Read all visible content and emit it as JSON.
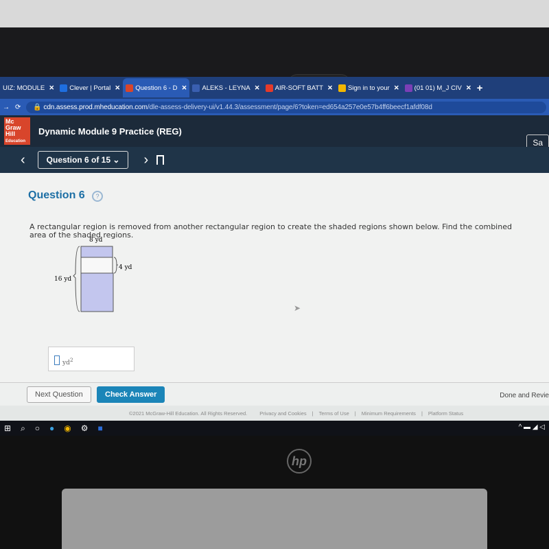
{
  "browser": {
    "tabs": [
      {
        "label": "UIZ: MODULE",
        "icon": "quiz-icon",
        "color": "#1f3f7a"
      },
      {
        "label": "Clever | Portal",
        "icon": "clever-icon",
        "color": "#1e6ee0"
      },
      {
        "label": "Question 6 - D",
        "icon": "mcgraw-hill-icon",
        "color": "#d8452b",
        "active": true
      },
      {
        "label": "ALEKS - LEYNA",
        "icon": "aleks-icon",
        "color": "#3a5fb0"
      },
      {
        "label": "AIR-SOFT BATT",
        "icon": "youtube-icon",
        "color": "#e53a2a"
      },
      {
        "label": "Sign in to your",
        "icon": "microsoft-icon",
        "color": "#f2b600"
      },
      {
        "label": "(01 01) M_J CIV",
        "icon": "onenote-icon",
        "color": "#7b3fb6"
      }
    ],
    "new_tab": "+",
    "url_host": "cdn.assess.prod.mheducation.com",
    "url_path": "/dle-assess-delivery-ui/v1.44.3/assessment/page/6?token=ed654a257e0e57b4ff6beecf1afdf08d"
  },
  "header": {
    "logo": "Mc Graw Hill Education",
    "logo_lines": [
      "Mc",
      "Graw",
      "Hill"
    ],
    "logo_sub": "Education",
    "title": "Dynamic Module 9 Practice (REG)",
    "save_label": "Sa"
  },
  "nav": {
    "question_selector": "Question 6 of 15"
  },
  "question": {
    "title": "Question 6",
    "text": "A rectangular region is removed from another rectangular region to create the shaded regions shown below. Find the combined area of the shaded regions.",
    "figure": {
      "width_label": "8 yd",
      "height_label": "16 yd",
      "removed_label": "4 yd",
      "shade_color": "#c3c6ee"
    },
    "answer_value": "",
    "answer_unit": "yd",
    "answer_exp": "2"
  },
  "buttons": {
    "next": "Next Question",
    "check": "Check Answer",
    "done": "Done and Revie"
  },
  "footer": {
    "copyright": "©2021 McGraw-Hill Education. All Rights Reserved.",
    "links": [
      "Privacy and Cookies",
      "Terms of Use",
      "Minimum Requirements",
      "Platform Status"
    ]
  },
  "laptop": {
    "brand": "hp"
  }
}
